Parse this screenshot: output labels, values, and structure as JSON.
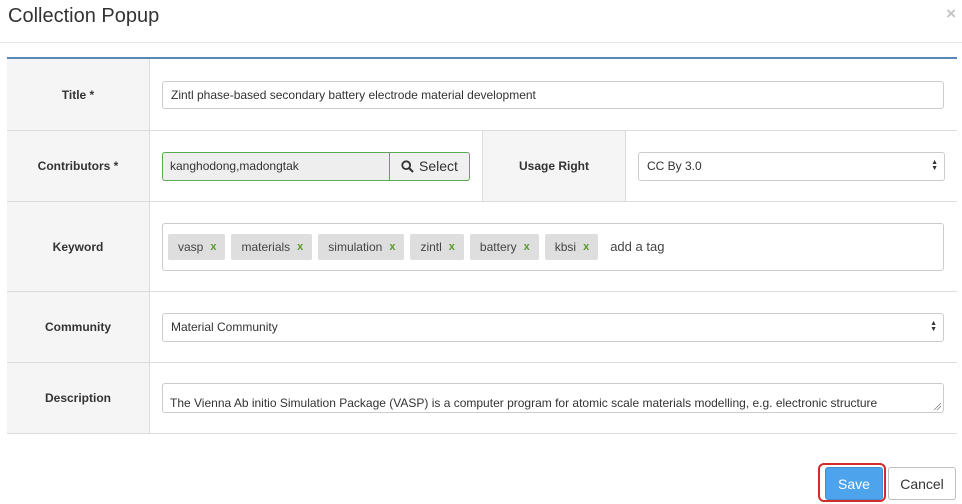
{
  "dialog": {
    "title": "Collection Popup",
    "close_label": "×"
  },
  "fields": {
    "title": {
      "label": "Title *",
      "value": "Zintl phase-based secondary battery electrode material development"
    },
    "contributors": {
      "label": "Contributors *",
      "value": "kanghodong,madongtak",
      "select_label": "Select",
      "select_icon": "search-icon"
    },
    "usage_right": {
      "label": "Usage Right",
      "value": "CC By 3.0"
    },
    "keyword": {
      "label": "Keyword",
      "tags": [
        "vasp",
        "materials",
        "simulation",
        "zintl",
        "battery",
        "kbsi"
      ],
      "remove_label": "x",
      "add_placeholder": "add a tag"
    },
    "community": {
      "label": "Community",
      "value": "Material Community"
    },
    "description": {
      "label": "Description",
      "value": "The Vienna Ab initio Simulation Package (VASP) is a computer program for atomic scale materials modelling, e.g. electronic structure"
    }
  },
  "footer": {
    "save_label": "Save",
    "cancel_label": "Cancel"
  },
  "colors": {
    "accent": "#5b87b6",
    "save": "#4da3ec",
    "highlight": "#d12b2b",
    "tag_remove": "#5a9a2c"
  }
}
